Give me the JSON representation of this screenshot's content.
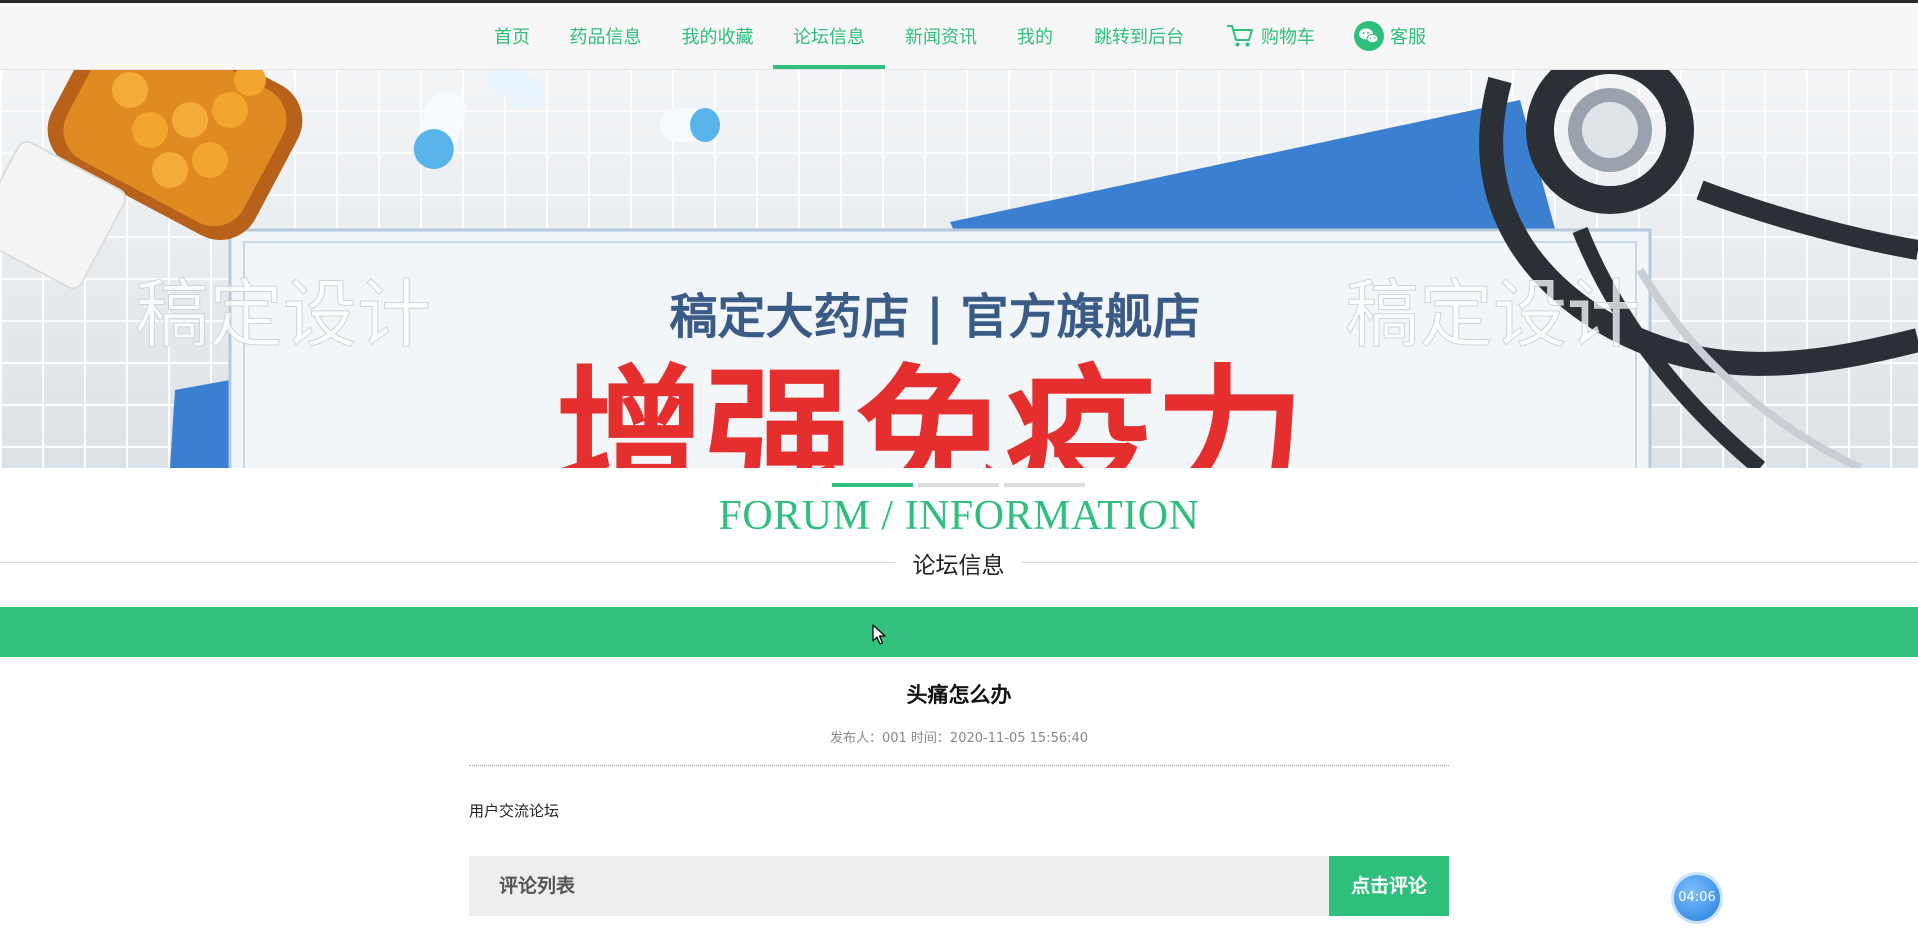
{
  "nav": {
    "items": [
      {
        "label": "首页"
      },
      {
        "label": "药品信息"
      },
      {
        "label": "我的收藏"
      },
      {
        "label": "论坛信息"
      },
      {
        "label": "新闻资讯"
      },
      {
        "label": "我的"
      },
      {
        "label": "跳转到后台"
      },
      {
        "label": "购物车",
        "icon": "cart-icon"
      },
      {
        "label": "客服",
        "icon": "wechat-icon"
      }
    ],
    "active": "论坛信息"
  },
  "banner": {
    "store_name": "稿定大药店 | 官方旗舰店",
    "headline": "增强免疫力",
    "watermark": "稿定设计"
  },
  "carousel": {
    "slides": 3,
    "active_index": 0
  },
  "section": {
    "title_en": "FORUM / INFORMATION",
    "title_cn": "论坛信息"
  },
  "post": {
    "title": "头痛怎么办",
    "meta": "发布人：001 时间：2020-11-05 15:56:40",
    "content": "用户交流论坛"
  },
  "comments": {
    "header": "评论列表",
    "button": "点击评论"
  },
  "timer": "04:06",
  "colors": {
    "accent": "#2fbf7c",
    "bar": "#33c27d"
  }
}
